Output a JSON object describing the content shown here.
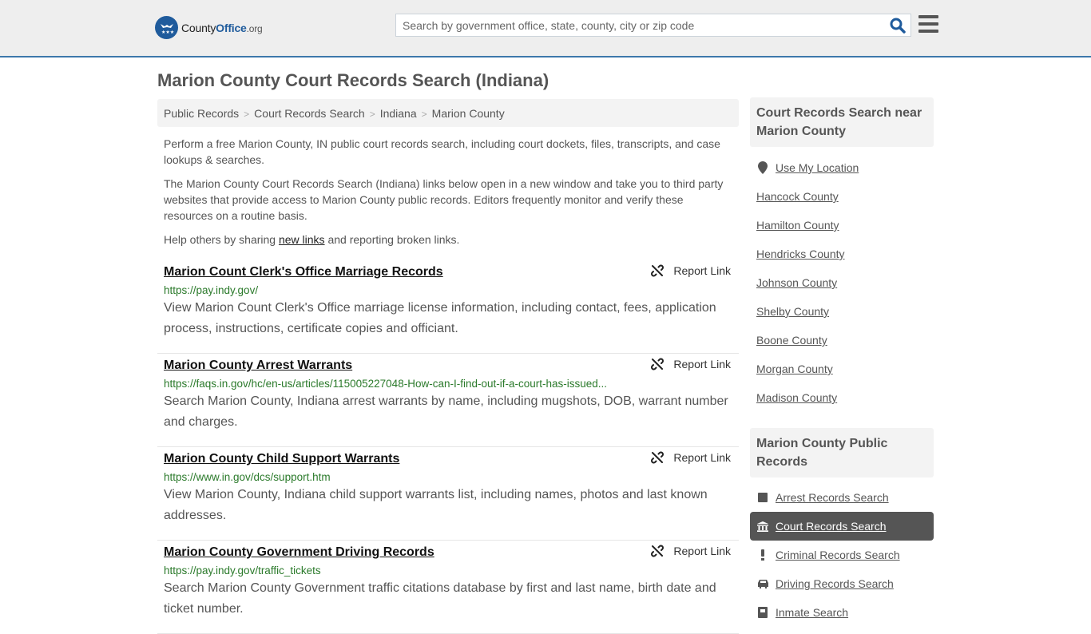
{
  "header": {
    "logo": {
      "name_prefix": "County",
      "name_bold": "Office",
      "suffix": ".org",
      "icon": "eagle-stars-badge-icon"
    },
    "search": {
      "placeholder": "Search by government office, state, county, city or zip code",
      "value": "",
      "icon": "search-icon"
    },
    "menu_icon": "hamburger-menu-icon",
    "colors": {
      "brand": "#1f5b9c",
      "header_bg": "#eeeeee",
      "header_border": "#3d78ab"
    }
  },
  "page": {
    "title": "Marion County Court Records Search (Indiana)",
    "breadcrumb": [
      "Public Records",
      "Court Records Search",
      "Indiana",
      "Marion County"
    ],
    "intro": {
      "p1": "Perform a free Marion County, IN public court records search, including court dockets, files, transcripts, and case lookups & searches.",
      "p2": "The Marion County Court Records Search (Indiana) links below open in a new window and take you to third party websites that provide access to Marion County public records. Editors frequently monitor and verify these resources on a routine basis.",
      "p3_before": "Help others by sharing ",
      "p3_link": "new links",
      "p3_after": " and reporting broken links."
    },
    "report_label": "Report Link",
    "results": [
      {
        "title": "Marion Count Clerk's Office Marriage Records",
        "url": "https://pay.indy.gov/",
        "desc": "View Marion Count Clerk's Office marriage license information, including contact, fees, application process, instructions, certificate copies and officiant."
      },
      {
        "title": "Marion County Arrest Warrants",
        "url": "https://faqs.in.gov/hc/en-us/articles/115005227048-How-can-I-find-out-if-a-court-has-issued...",
        "desc": "Search Marion County, Indiana arrest warrants by name, including mugshots, DOB, warrant number and charges."
      },
      {
        "title": "Marion County Child Support Warrants",
        "url": "https://www.in.gov/dcs/support.htm",
        "desc": "View Marion County, Indiana child support warrants list, including names, photos and last known addresses."
      },
      {
        "title": "Marion County Government Driving Records",
        "url": "https://pay.indy.gov/traffic_tickets",
        "desc": "Search Marion County Government traffic citations database by first and last name, birth date and ticket number."
      }
    ]
  },
  "sidebar": {
    "nearby": {
      "heading": "Court Records Search near Marion County",
      "use_location": "Use My Location",
      "counties": [
        "Hancock County",
        "Hamilton County",
        "Hendricks County",
        "Johnson County",
        "Shelby County",
        "Boone County",
        "Morgan County",
        "Madison County"
      ]
    },
    "public_records": {
      "heading": "Marion County Public Records",
      "items": [
        {
          "label": "Arrest Records Search",
          "icon": "square-icon",
          "active": false
        },
        {
          "label": "Court Records Search",
          "icon": "courthouse-icon",
          "active": true
        },
        {
          "label": "Criminal Records Search",
          "icon": "exclamation-icon",
          "active": false
        },
        {
          "label": "Driving Records Search",
          "icon": "car-icon",
          "active": false
        },
        {
          "label": "Inmate Search",
          "icon": "inmate-icon",
          "active": false
        }
      ]
    }
  }
}
